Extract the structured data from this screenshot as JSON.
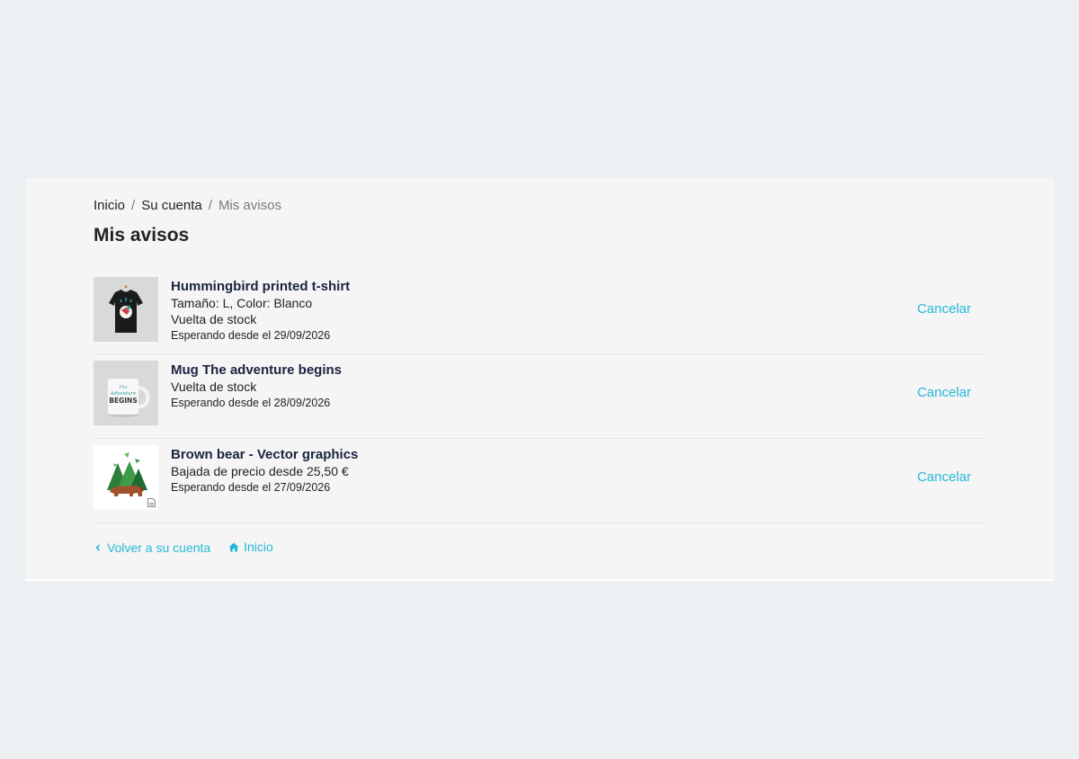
{
  "breadcrumb": {
    "home": "Inicio",
    "separator": "/",
    "account": "Su cuenta",
    "current": "Mis avisos"
  },
  "page_title": "Mis avisos",
  "alerts": [
    {
      "name": "Hummingbird printed t-shirt",
      "attributes": "Tamaño: L, Color: Blanco",
      "type": "Vuelta de stock",
      "since": "Esperando desde el 29/09/2026",
      "cancel": "Cancelar"
    },
    {
      "name": "Mug The adventure begins",
      "type": "Vuelta de stock",
      "since": "Esperando desde el 28/09/2026",
      "cancel": "Cancelar"
    },
    {
      "name": "Brown bear - Vector graphics",
      "type": "Bajada de precio desde 25,50 €",
      "since": "Esperando desde el 27/09/2026",
      "cancel": "Cancelar"
    }
  ],
  "mug_print": {
    "line1": "The",
    "line2": "Adventure",
    "line3": "BEGINS"
  },
  "footer": {
    "back": "Volver a su cuenta",
    "home": "Inicio"
  },
  "colors": {
    "accent": "#24b9d7",
    "page_bg": "#edf0f3",
    "panel_bg": "#f5f5f5",
    "title": "#1a2440"
  },
  "icons": {
    "back": "chevron-left-icon",
    "home": "home-icon",
    "file": "file-icon"
  }
}
